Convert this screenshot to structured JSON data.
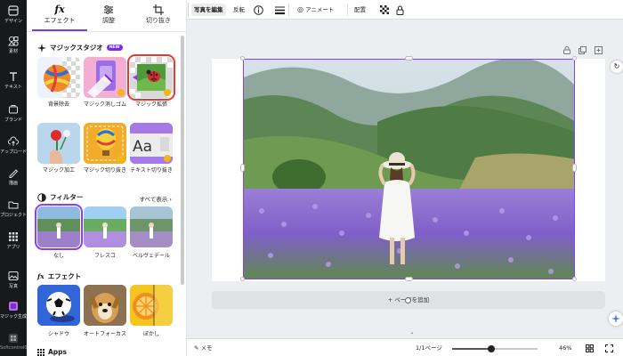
{
  "rail": {
    "items": [
      {
        "label": "デザイン",
        "icon": "design-icon"
      },
      {
        "label": "素材",
        "icon": "elements-icon"
      },
      {
        "label": "テキスト",
        "icon": "text-icon"
      },
      {
        "label": "ブランド",
        "icon": "brand-icon"
      },
      {
        "label": "アップロード",
        "icon": "upload-icon"
      },
      {
        "label": "描画",
        "icon": "draw-icon"
      },
      {
        "label": "プロジェクト",
        "icon": "folder-icon"
      },
      {
        "label": "アプリ",
        "icon": "apps-icon"
      },
      {
        "label": "写真",
        "icon": "photo-icon"
      },
      {
        "label": "マジック生成",
        "icon": "magic-media-icon"
      },
      {
        "label": "Softcontrol03",
        "icon": "app-icon"
      }
    ]
  },
  "panel": {
    "tabs": [
      {
        "label": "エフェクト",
        "icon": "fx"
      },
      {
        "label": "調整",
        "icon": "adjust-icon"
      },
      {
        "label": "切り抜き",
        "icon": "crop-icon"
      }
    ],
    "magic_studio": {
      "title": "マジックスタジオ",
      "badge": "NEW",
      "tools": [
        "背景除去",
        "マジック消しゴム",
        "マジック拡張",
        "マジック加工",
        "マジック切り抜き",
        "テキスト切り抜き"
      ]
    },
    "filters": {
      "title": "フィルター",
      "see_all": "すべて表示",
      "items": [
        "なし",
        "フレスコ",
        "ベルヴェデール"
      ]
    },
    "effects": {
      "title": "エフェクト",
      "items": [
        "シャドウ",
        "オートフォーカス",
        "ぼかし"
      ]
    },
    "apps_title": "Apps"
  },
  "toolbar": {
    "edit_photo": "写真を編集",
    "flip": "反転",
    "animate": "アニメート",
    "position": "配置"
  },
  "canvas": {
    "add_page": "+ ページを追加"
  },
  "bottombar": {
    "notes": "メモ",
    "page_count": "1/1ページ",
    "zoom": "46%",
    "zoom_fraction": 0.46
  },
  "colors": {
    "accent": "#8b3dff",
    "selected_outline": "#e6392f",
    "rail_bg": "#18191b"
  }
}
